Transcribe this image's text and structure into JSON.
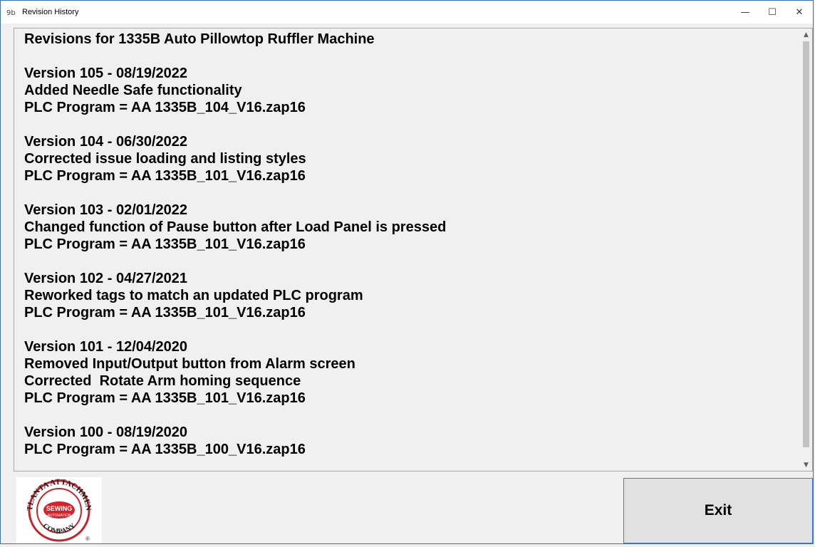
{
  "window": {
    "title": "Revision History",
    "icon": "app-icon",
    "controls": {
      "minimize": "—",
      "maximize": "☐",
      "close": "✕"
    }
  },
  "content": {
    "heading": "Revisions for 1335B Auto Pillowtop Ruffler Machine",
    "revisions": [
      {
        "lines": [
          "Version 105 - 08/19/2022",
          "Added Needle Safe functionality",
          "PLC Program = AA 1335B_104_V16.zap16"
        ]
      },
      {
        "lines": [
          "Version 104 - 06/30/2022",
          "Corrected issue loading and listing styles",
          "PLC Program = AA 1335B_101_V16.zap16"
        ]
      },
      {
        "lines": [
          "Version 103 - 02/01/2022",
          "Changed function of Pause button after Load Panel is pressed",
          "PLC Program = AA 1335B_101_V16.zap16"
        ]
      },
      {
        "lines": [
          "Version 102 - 04/27/2021",
          "Reworked tags to match an updated PLC program",
          "PLC Program = AA 1335B_101_V16.zap16"
        ]
      },
      {
        "lines": [
          "Version 101 - 12/04/2020",
          "Removed Input/Output button from Alarm screen",
          "Corrected  Rotate Arm homing sequence",
          "PLC Program = AA 1335B_101_V16.zap16"
        ]
      },
      {
        "lines": [
          "Version 100 - 08/19/2020",
          "PLC Program = AA 1335B_100_V16.zap16"
        ]
      }
    ]
  },
  "logo": {
    "top_text": "ATLANTA ATTACHMENT",
    "bottom_text": "COMPANY",
    "center_top": "SEWING",
    "center_bottom": "AUTOMATION",
    "registered": "®",
    "colors": {
      "ring": "#c8242b",
      "center": "#d8222a"
    }
  },
  "exit_button": {
    "label": "Exit"
  },
  "colors": {
    "accent_border": "#3c7fc8"
  }
}
